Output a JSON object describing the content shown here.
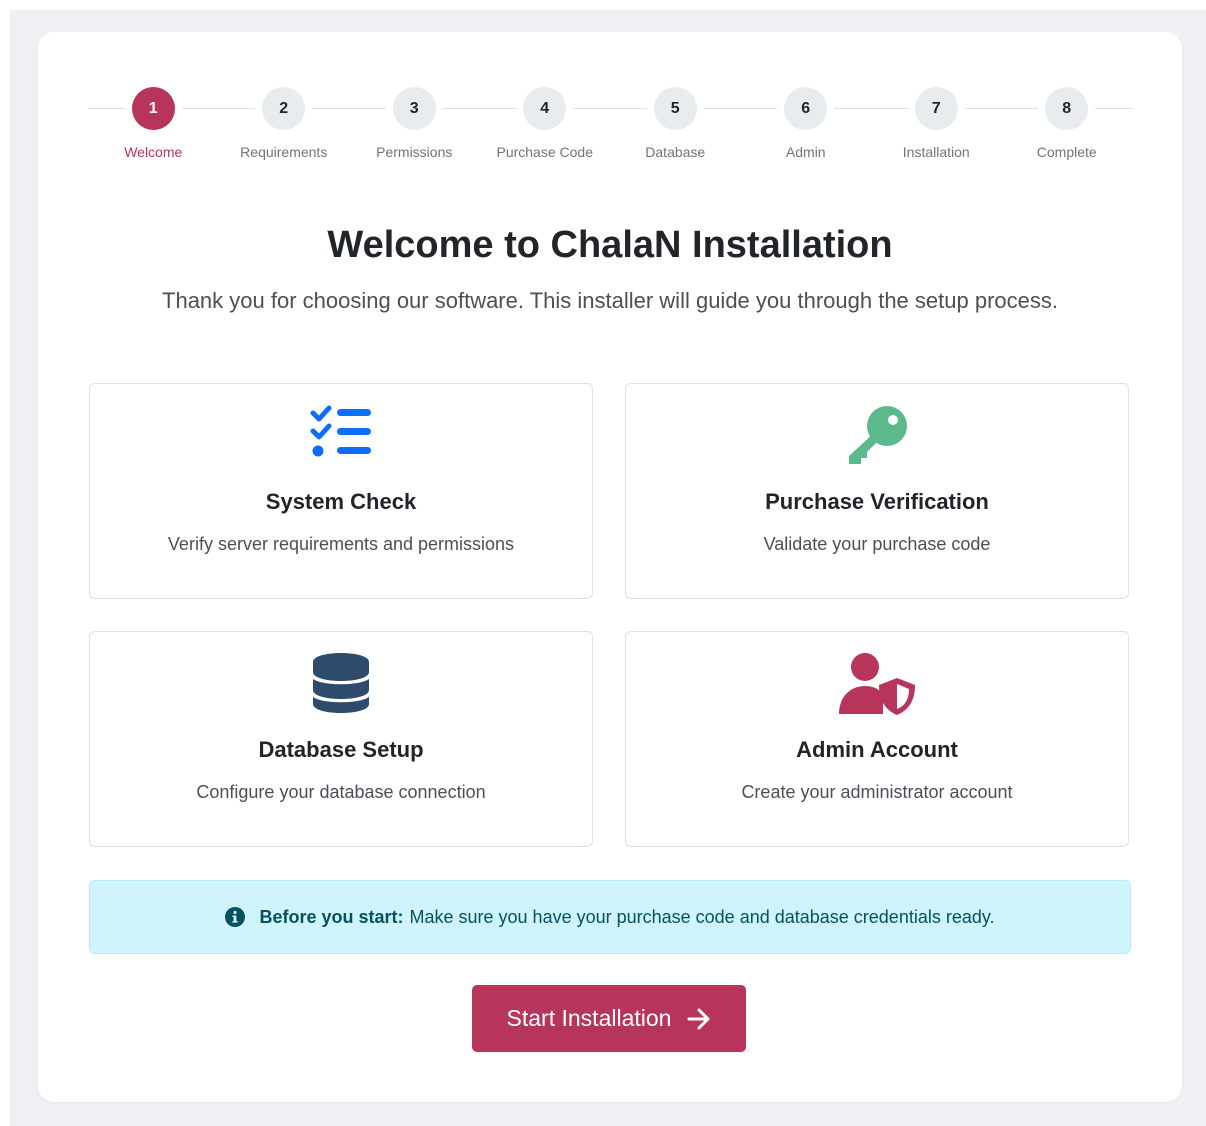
{
  "stepper": {
    "steps": [
      {
        "num": "1",
        "label": "Welcome"
      },
      {
        "num": "2",
        "label": "Requirements"
      },
      {
        "num": "3",
        "label": "Permissions"
      },
      {
        "num": "4",
        "label": "Purchase Code"
      },
      {
        "num": "5",
        "label": "Database"
      },
      {
        "num": "6",
        "label": "Admin"
      },
      {
        "num": "7",
        "label": "Installation"
      },
      {
        "num": "8",
        "label": "Complete"
      }
    ],
    "active_step": 1
  },
  "header": {
    "title": "Welcome to ChalaN Installation",
    "subtitle": "Thank you for choosing our software. This installer will guide you through the setup process."
  },
  "features": [
    {
      "icon": "checklist-icon",
      "title": "System Check",
      "description": "Verify server requirements and permissions",
      "color": "#0d6efd"
    },
    {
      "icon": "key-icon",
      "title": "Purchase Verification",
      "description": "Validate your purchase code",
      "color": "#5cb98b"
    },
    {
      "icon": "database-icon",
      "title": "Database Setup",
      "description": "Configure your database connection",
      "color": "#2f4b6b"
    },
    {
      "icon": "user-shield-icon",
      "title": "Admin Account",
      "description": "Create your administrator account",
      "color": "#b7345b"
    }
  ],
  "alert": {
    "icon": "info-circle-icon",
    "bold": "Before you start:",
    "text": "Make sure you have your purchase code and database credentials ready."
  },
  "start_button": {
    "label": "Start Installation",
    "icon": "arrow-right-icon"
  },
  "colors": {
    "accent": "#b7345b",
    "alert_bg": "#cff4fc",
    "alert_text": "#055160"
  }
}
